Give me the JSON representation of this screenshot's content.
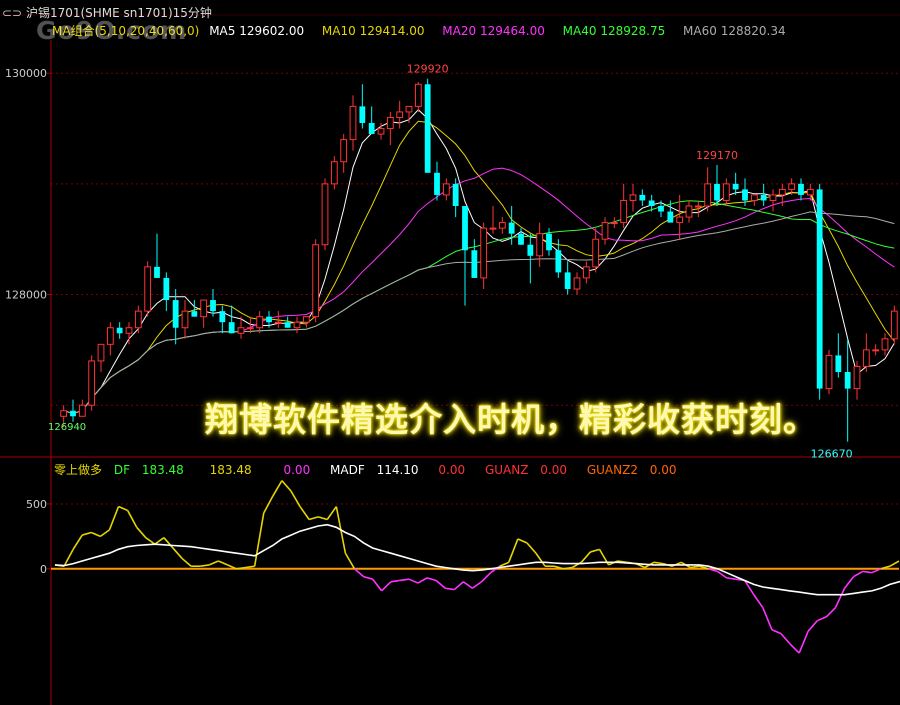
{
  "window": {
    "title": "沪锡1701(SHME sn1701)15分钟"
  },
  "watermark": "Go9O.com",
  "overlay_text": "翔博软件精选介入时机，精彩收获时刻。",
  "main_panel": {
    "ma_legend": [
      {
        "label": "MA组合(5,10,20,40,60,0)",
        "color": "#e5d600"
      },
      {
        "label": "MA5 129602.00",
        "color": "#ffffff"
      },
      {
        "label": "MA10 129414.00",
        "color": "#e5d600"
      },
      {
        "label": "MA20 129464.00",
        "color": "#ff33ff"
      },
      {
        "label": "MA40 128928.75",
        "color": "#33ff33"
      },
      {
        "label": "MA60 128820.34",
        "color": "#aaaaaa"
      }
    ],
    "y_ticks": [
      "130000",
      "128000"
    ],
    "price_labels": {
      "high": "129920",
      "mid_high": "129170",
      "low": "126670",
      "first": "126940"
    }
  },
  "sub_panel": {
    "legend": [
      {
        "label": "零上做多",
        "color": "#e5d600"
      },
      {
        "label": "DF",
        "color": "#33ff33"
      },
      {
        "label": "183.48",
        "color": "#33ff33"
      },
      {
        "label": "183.48",
        "color": "#e5d600"
      },
      {
        "label": "0.00",
        "color": "#ff33ff"
      },
      {
        "label": "MADF",
        "color": "#ffffff"
      },
      {
        "label": "114.10",
        "color": "#ffffff"
      },
      {
        "label": "0.00",
        "color": "#ff3333"
      },
      {
        "label": "GUANZ",
        "color": "#ff3333"
      },
      {
        "label": "0.00",
        "color": "#ff3333"
      },
      {
        "label": "GUANZ2",
        "color": "#ff6600"
      },
      {
        "label": "0.00",
        "color": "#ff6600"
      }
    ],
    "y_ticks": [
      "500",
      "0"
    ]
  },
  "colors": {
    "up": "#ff3333",
    "down": "#00ffff",
    "grid": "#7a0000",
    "axis": "#aa0000"
  },
  "chart_data": [
    {
      "type": "candlestick",
      "title": "沪锡1701(SHME sn1701)15分钟",
      "ylim": [
        126550,
        130300
      ],
      "candles": [
        [
          126900,
          127000,
          126800,
          126950
        ],
        [
          126950,
          127050,
          126850,
          126900
        ],
        [
          126900,
          127050,
          126900,
          127000
        ],
        [
          127000,
          127450,
          126950,
          127400
        ],
        [
          127400,
          127550,
          127300,
          127550
        ],
        [
          127550,
          127750,
          127450,
          127700
        ],
        [
          127700,
          127750,
          127600,
          127650
        ],
        [
          127650,
          127750,
          127550,
          127700
        ],
        [
          127700,
          127900,
          127650,
          127850
        ],
        [
          127850,
          128300,
          127800,
          128250
        ],
        [
          128250,
          128550,
          128150,
          128150
        ],
        [
          128150,
          128200,
          127850,
          127950
        ],
        [
          127950,
          128050,
          127550,
          127700
        ],
        [
          127700,
          127950,
          127600,
          127850
        ],
        [
          127850,
          127950,
          127800,
          127800
        ],
        [
          127800,
          127950,
          127700,
          127950
        ],
        [
          127950,
          128050,
          127800,
          127850
        ],
        [
          127850,
          127900,
          127650,
          127750
        ],
        [
          127750,
          127900,
          127650,
          127650
        ],
        [
          127650,
          127800,
          127600,
          127700
        ],
        [
          127700,
          127800,
          127650,
          127700
        ],
        [
          127700,
          127850,
          127650,
          127800
        ],
        [
          127800,
          127850,
          127700,
          127750
        ],
        [
          127750,
          127850,
          127700,
          127750
        ],
        [
          127750,
          127800,
          127700,
          127700
        ],
        [
          127700,
          127800,
          127650,
          127750
        ],
        [
          127750,
          127800,
          127700,
          127800
        ],
        [
          127800,
          128500,
          127750,
          128450
        ],
        [
          128450,
          129050,
          128400,
          129000
        ],
        [
          129000,
          129250,
          128950,
          129200
        ],
        [
          129200,
          129450,
          129100,
          129400
        ],
        [
          129400,
          129800,
          129300,
          129700
        ],
        [
          129700,
          129900,
          129500,
          129550
        ],
        [
          129550,
          129700,
          129450,
          129450
        ],
        [
          129450,
          129550,
          129400,
          129500
        ],
        [
          129500,
          129650,
          129350,
          129600
        ],
        [
          129600,
          129750,
          129500,
          129650
        ],
        [
          129650,
          129700,
          129550,
          129700
        ],
        [
          129700,
          129920,
          129650,
          129900
        ],
        [
          129900,
          129950,
          129500,
          129100
        ],
        [
          129100,
          129200,
          128850,
          128900
        ],
        [
          128900,
          129050,
          128850,
          129000
        ],
        [
          129000,
          129050,
          128700,
          128800
        ],
        [
          128800,
          128800,
          127900,
          128400
        ],
        [
          128400,
          128500,
          128150,
          128150
        ],
        [
          128150,
          128650,
          128050,
          128600
        ],
        [
          128600,
          128800,
          128550,
          128600
        ],
        [
          128600,
          128700,
          128550,
          128650
        ],
        [
          128650,
          128800,
          128450,
          128550
        ],
        [
          128550,
          128600,
          128450,
          128450
        ],
        [
          128450,
          128550,
          128100,
          128350
        ],
        [
          128350,
          128650,
          128250,
          128550
        ],
        [
          128550,
          128600,
          128350,
          128400
        ],
        [
          128400,
          128500,
          128150,
          128200
        ],
        [
          128200,
          128300,
          128000,
          128050
        ],
        [
          128050,
          128200,
          128000,
          128150
        ],
        [
          128150,
          128300,
          128100,
          128250
        ],
        [
          128250,
          128600,
          128200,
          128500
        ],
        [
          128500,
          128700,
          128450,
          128650
        ],
        [
          128650,
          128700,
          128600,
          128650
        ],
        [
          128650,
          129000,
          128600,
          128850
        ],
        [
          128850,
          129000,
          128750,
          128900
        ],
        [
          128900,
          128950,
          128800,
          128850
        ],
        [
          128850,
          128900,
          128750,
          128800
        ],
        [
          128800,
          128850,
          128700,
          128750
        ],
        [
          128750,
          128850,
          128650,
          128650
        ],
        [
          128650,
          128900,
          128500,
          128700
        ],
        [
          128700,
          128850,
          128650,
          128800
        ],
        [
          128800,
          128850,
          128700,
          128800
        ],
        [
          128800,
          129150,
          128750,
          129000
        ],
        [
          129000,
          129170,
          128800,
          128850
        ],
        [
          128850,
          129050,
          128800,
          129000
        ],
        [
          129000,
          129100,
          128900,
          128950
        ],
        [
          128950,
          129050,
          128800,
          128850
        ],
        [
          128850,
          128900,
          128800,
          128900
        ],
        [
          128900,
          129000,
          128800,
          128850
        ],
        [
          128850,
          128950,
          128750,
          128900
        ],
        [
          128900,
          129000,
          128800,
          128950
        ],
        [
          128950,
          129050,
          128900,
          129000
        ],
        [
          129000,
          129050,
          128850,
          128900
        ],
        [
          128900,
          129000,
          128850,
          128950
        ],
        [
          128950,
          129000,
          127050,
          127150
        ],
        [
          127150,
          127500,
          127100,
          127450
        ],
        [
          127450,
          127650,
          127250,
          127300
        ],
        [
          127300,
          127600,
          126670,
          127150
        ],
        [
          127150,
          127400,
          127050,
          127350
        ],
        [
          127350,
          127650,
          127300,
          127500
        ],
        [
          127500,
          127550,
          127450,
          127500
        ],
        [
          127500,
          127650,
          127450,
          127600
        ],
        [
          127600,
          127900,
          127550,
          127850
        ]
      ],
      "ma_series": [
        "MA5",
        "MA10",
        "MA20",
        "MA40",
        "MA60"
      ]
    },
    {
      "type": "line",
      "title": "零上做多",
      "ylim": [
        -1050,
        700
      ],
      "series": [
        {
          "name": "DF",
          "values": [
            30,
            20,
            150,
            260,
            280,
            250,
            300,
            480,
            450,
            320,
            240,
            190,
            240,
            160,
            80,
            20,
            20,
            30,
            60,
            30,
            0,
            10,
            20,
            430,
            560,
            680,
            600,
            480,
            380,
            400,
            380,
            480,
            120,
            0,
            -60,
            -80,
            -170,
            -100,
            -90,
            -80,
            -110,
            -70,
            -90,
            -150,
            -160,
            -100,
            -150,
            -100,
            -30,
            20,
            50,
            230,
            200,
            120,
            20,
            20,
            0,
            10,
            50,
            130,
            150,
            30,
            60,
            50,
            40,
            10,
            50,
            40,
            20,
            50,
            10,
            20,
            0,
            -20,
            -70,
            -80,
            -90,
            -200,
            -300,
            -470,
            -500,
            -580,
            -650,
            -480,
            -400,
            -370,
            -300,
            -150,
            -60,
            -20,
            -30,
            0,
            20,
            60
          ]
        },
        {
          "name": "MADF",
          "values": [
            30,
            25,
            40,
            60,
            80,
            100,
            120,
            150,
            170,
            180,
            185,
            190,
            185,
            180,
            175,
            170,
            160,
            150,
            140,
            130,
            120,
            110,
            100,
            140,
            180,
            230,
            260,
            290,
            310,
            330,
            340,
            320,
            280,
            250,
            200,
            160,
            140,
            120,
            100,
            80,
            60,
            40,
            20,
            10,
            0,
            -10,
            -15,
            -10,
            0,
            10,
            20,
            30,
            40,
            50,
            50,
            45,
            40,
            40,
            40,
            45,
            50,
            50,
            50,
            45,
            40,
            35,
            30,
            30,
            30,
            30,
            30,
            30,
            20,
            0,
            -30,
            -60,
            -90,
            -120,
            -140,
            -150,
            -160,
            -170,
            -180,
            -190,
            -200,
            -200,
            -200,
            -200,
            -190,
            -180,
            -170,
            -150,
            -120,
            -100,
            -80
          ]
        }
      ]
    }
  ]
}
